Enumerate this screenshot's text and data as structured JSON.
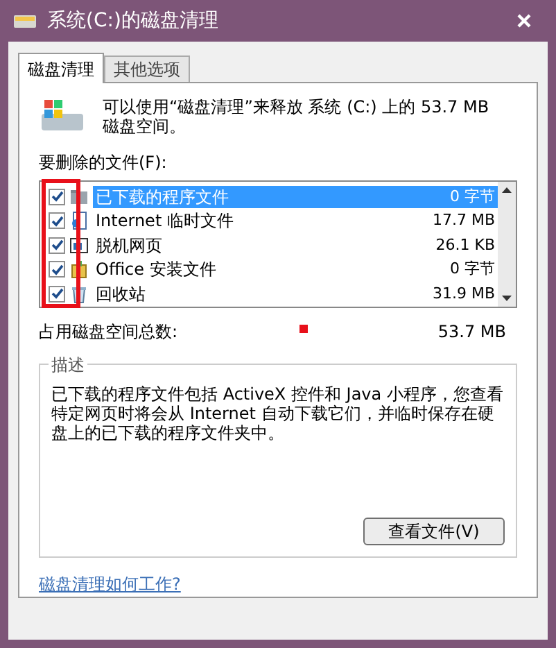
{
  "window": {
    "title": "系统(C:)的磁盘清理"
  },
  "tabs": [
    {
      "label": "磁盘清理",
      "selected": true
    },
    {
      "label": "其他选项",
      "selected": false
    }
  ],
  "intro": "可以使用“磁盘清理”来释放 系统 (C:) 上的 53.7 MB 磁盘空间。",
  "files_label": "要删除的文件(F):",
  "files": [
    {
      "kind": "folder",
      "name": "已下载的程序文件",
      "size": "0 字节",
      "checked": true,
      "selected": true
    },
    {
      "kind": "internet",
      "name": "Internet 临时文件",
      "size": "17.7 MB",
      "checked": true,
      "selected": false
    },
    {
      "kind": "webpage",
      "name": "脱机网页",
      "size": "26.1 KB",
      "checked": true,
      "selected": false
    },
    {
      "kind": "installer",
      "name": "Office 安装文件",
      "size": "0 字节",
      "checked": true,
      "selected": false
    },
    {
      "kind": "recycle",
      "name": "回收站",
      "size": "31.9 MB",
      "checked": true,
      "selected": false
    }
  ],
  "total": {
    "label": "占用磁盘空间总数:",
    "value": "53.7 MB"
  },
  "description": {
    "title": "描述",
    "text": "已下载的程序文件包括 ActiveX 控件和 Java 小程序，您查看特定网页时将会从 Internet 自动下载它们，并临时保存在硬盘上的已下载的程序文件夹中。"
  },
  "view_button": "查看文件(V)",
  "help_link": "磁盘清理如何工作?"
}
